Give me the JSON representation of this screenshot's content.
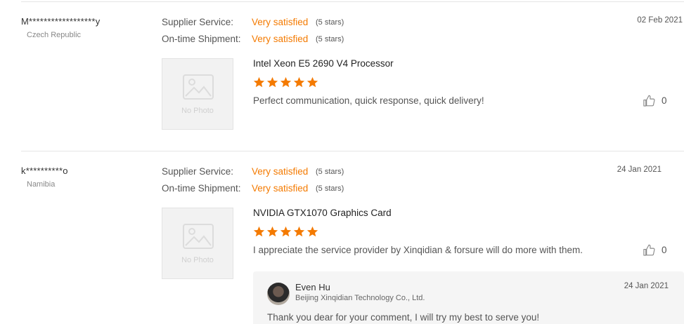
{
  "accent_color": "#f47a00",
  "star_color": "#f47a00",
  "labels": {
    "supplier_service": "Supplier Service:",
    "ontime_shipment": "On-time Shipment:",
    "no_photo": "No Photo"
  },
  "reviews": [
    {
      "buyer": "M******************y",
      "country": "Czech Republic",
      "supplier_rating": "Very satisfied",
      "supplier_stars": "(5 stars)",
      "shipment_rating": "Very satisfied",
      "shipment_stars": "(5 stars)",
      "date": "02 Feb 2021",
      "product": "Intel Xeon E5 2690 V4 Processor",
      "rating": 5,
      "comment": "Perfect communication, quick response, quick delivery!",
      "likes": "0"
    },
    {
      "buyer": "k**********o",
      "country": "Namibia",
      "supplier_rating": "Very satisfied",
      "supplier_stars": "(5 stars)",
      "shipment_rating": "Very satisfied",
      "shipment_stars": "(5 stars)",
      "date": "24 Jan 2021",
      "product": "NVIDIA GTX1070 Graphics Card",
      "rating": 5,
      "comment": "I appreciate the service provider by Xinqidian & forsure will do more with them.",
      "likes": "0",
      "reply": {
        "name": "Even Hu",
        "company": "Beijing Xinqidian Technology Co., Ltd.",
        "date": "24 Jan 2021",
        "text": "Thank you dear for your comment, I will try my best to serve you!"
      }
    }
  ]
}
